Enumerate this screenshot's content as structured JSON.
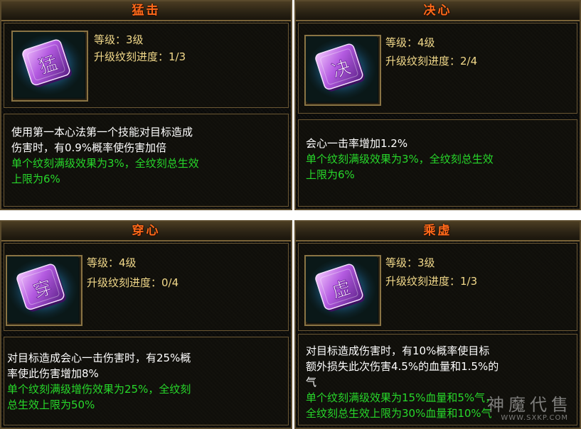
{
  "cards": [
    {
      "title": "猛击",
      "icon_glyph": "猛",
      "level": "等级：3级",
      "progress": "升级纹刻进度：1/3",
      "desc_white": [
        "使用第一本心法第一个技能对目标造成",
        "伤害时，有0.9%概率使伤害加倍"
      ],
      "desc_green": [
        "单个纹刻满级效果为3%，全纹刻总生效",
        "上限为6%"
      ]
    },
    {
      "title": "决心",
      "icon_glyph": "决",
      "level": "等级：4级",
      "progress": "升级纹刻进度：2/4",
      "desc_white": [
        "会心一击率增加1.2%"
      ],
      "desc_green": [
        "单个纹刻满级效果为3%，全纹刻总生效",
        "上限为6%"
      ]
    },
    {
      "title": "穿心",
      "icon_glyph": "穿",
      "level": "等级：4级",
      "progress": "升级纹刻进度：0/4",
      "desc_white": [
        "对目标造成会心一击伤害时，有25%概",
        "率使此伤害增加8%"
      ],
      "desc_green": [
        "单个纹刻满级增伤效果为25%，全纹刻",
        "总生效上限为50%"
      ]
    },
    {
      "title": "乘虚",
      "icon_glyph": "虚",
      "level": "等级：3级",
      "progress": "升级纹刻进度：1/3",
      "desc_white": [
        "对目标造成伤害时，有10%概率使目标",
        "额外损失此次伤害4.5%的血量和1.5%的",
        "气"
      ],
      "desc_green": [
        "单个纹刻满级效果为15%血量和5%气，",
        "全纹刻总生效上限为30%血量和10%气"
      ]
    }
  ],
  "watermark": {
    "text": "神魔代售",
    "url": "WWW.SXKP.COM"
  },
  "colors": {
    "title": "#ff6a1a",
    "stat": "#f2d98a",
    "desc_white": "#ffffff",
    "desc_green": "#27d82a",
    "border": "#6b5733"
  },
  "icons": [
    "rune-stone-icon",
    "rune-stone-icon",
    "rune-stone-icon",
    "rune-stone-icon"
  ]
}
